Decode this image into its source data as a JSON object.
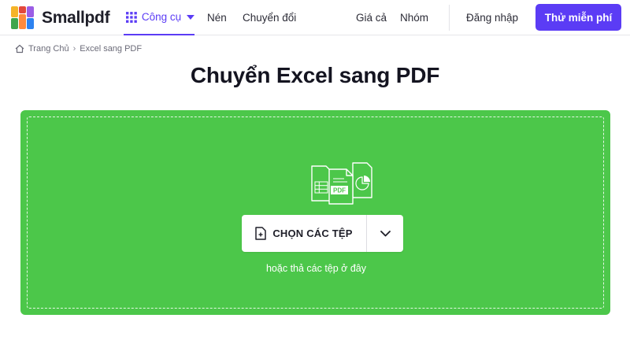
{
  "brand": {
    "name": "Smallpdf",
    "logo_colors": [
      "#f5b428",
      "#e3483c",
      "#3fa64b",
      "#2d82f0",
      "#9b5de5",
      "#ff8a3d"
    ]
  },
  "nav": {
    "tools_label": "Công cụ",
    "compress_label": "Nén",
    "convert_label": "Chuyển đổi",
    "pricing_label": "Giá cả",
    "team_label": "Nhóm",
    "login_label": "Đăng nhập",
    "trial_label": "Thử miễn phí",
    "accent_color": "#5b3cf5"
  },
  "breadcrumb": {
    "home_label": "Trang Chủ",
    "separator": "›",
    "current_label": "Excel sang PDF"
  },
  "page": {
    "title": "Chuyển Excel sang PDF"
  },
  "dropzone": {
    "background_color": "#4cc74a",
    "pdf_badge": "PDF",
    "choose_label": "CHỌN CÁC TỆP",
    "hint": "hoặc thả các tệp ở đây",
    "icons": [
      "spreadsheet-file-icon",
      "pdf-file-icon",
      "chart-file-icon",
      "file-plus-icon",
      "chevron-down-icon"
    ]
  }
}
